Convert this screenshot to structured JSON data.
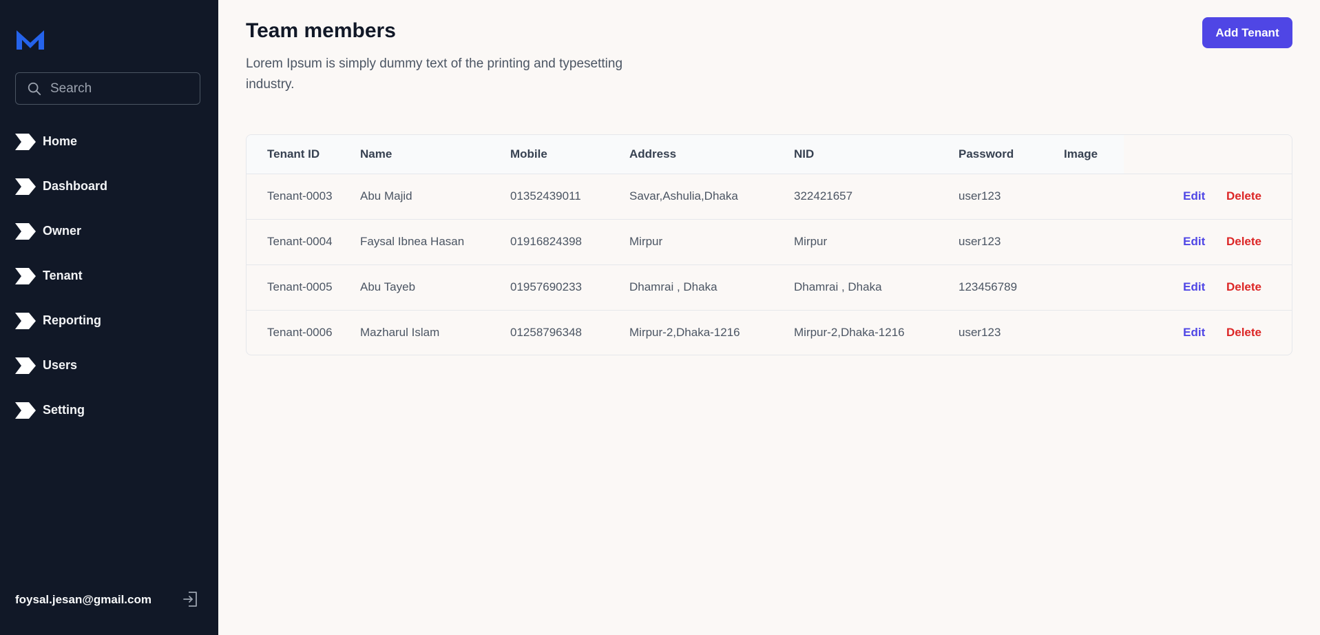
{
  "sidebar": {
    "search": {
      "placeholder": "Search"
    },
    "items": [
      {
        "label": "Home"
      },
      {
        "label": "Dashboard"
      },
      {
        "label": "Owner"
      },
      {
        "label": "Tenant"
      },
      {
        "label": "Reporting"
      },
      {
        "label": "Users"
      },
      {
        "label": "Setting"
      }
    ],
    "user_email": "foysal.jesan@gmail.com"
  },
  "header": {
    "title": "Team members",
    "subtitle": "Lorem Ipsum is simply dummy text of the printing and typesetting industry.",
    "add_button_label": "Add Tenant"
  },
  "table": {
    "columns": [
      "Tenant ID",
      "Name",
      "Mobile",
      "Address",
      "NID",
      "Password",
      "Image"
    ],
    "rows": [
      {
        "id": "Tenant-0003",
        "name": "Abu Majid",
        "mobile": "01352439011",
        "address": "Savar,Ashulia,Dhaka",
        "nid": "322421657",
        "password": "user123",
        "image": ""
      },
      {
        "id": "Tenant-0004",
        "name": "Faysal Ibnea Hasan",
        "mobile": "01916824398",
        "address": "Mirpur",
        "nid": "Mirpur",
        "password": "user123",
        "image": ""
      },
      {
        "id": "Tenant-0005",
        "name": "Abu Tayeb",
        "mobile": "01957690233",
        "address": "Dhamrai , Dhaka",
        "nid": "Dhamrai , Dhaka",
        "password": "123456789",
        "image": ""
      },
      {
        "id": "Tenant-0006",
        "name": "Mazharul Islam",
        "mobile": "01258796348",
        "address": "Mirpur-2,Dhaka-1216",
        "nid": "Mirpur-2,Dhaka-1216",
        "password": "user123",
        "image": ""
      }
    ],
    "edit_label": "Edit",
    "delete_label": "Delete"
  },
  "colors": {
    "sidebar_bg": "#111827",
    "accent": "#4f46e5",
    "danger": "#dc2626",
    "logo": "#2563eb",
    "page_bg": "#fbf8f6"
  },
  "icons": {
    "logo": "brand-logo-icon",
    "search": "search-icon",
    "nav": "chevron-arrow-icon",
    "logout": "logout-icon"
  }
}
